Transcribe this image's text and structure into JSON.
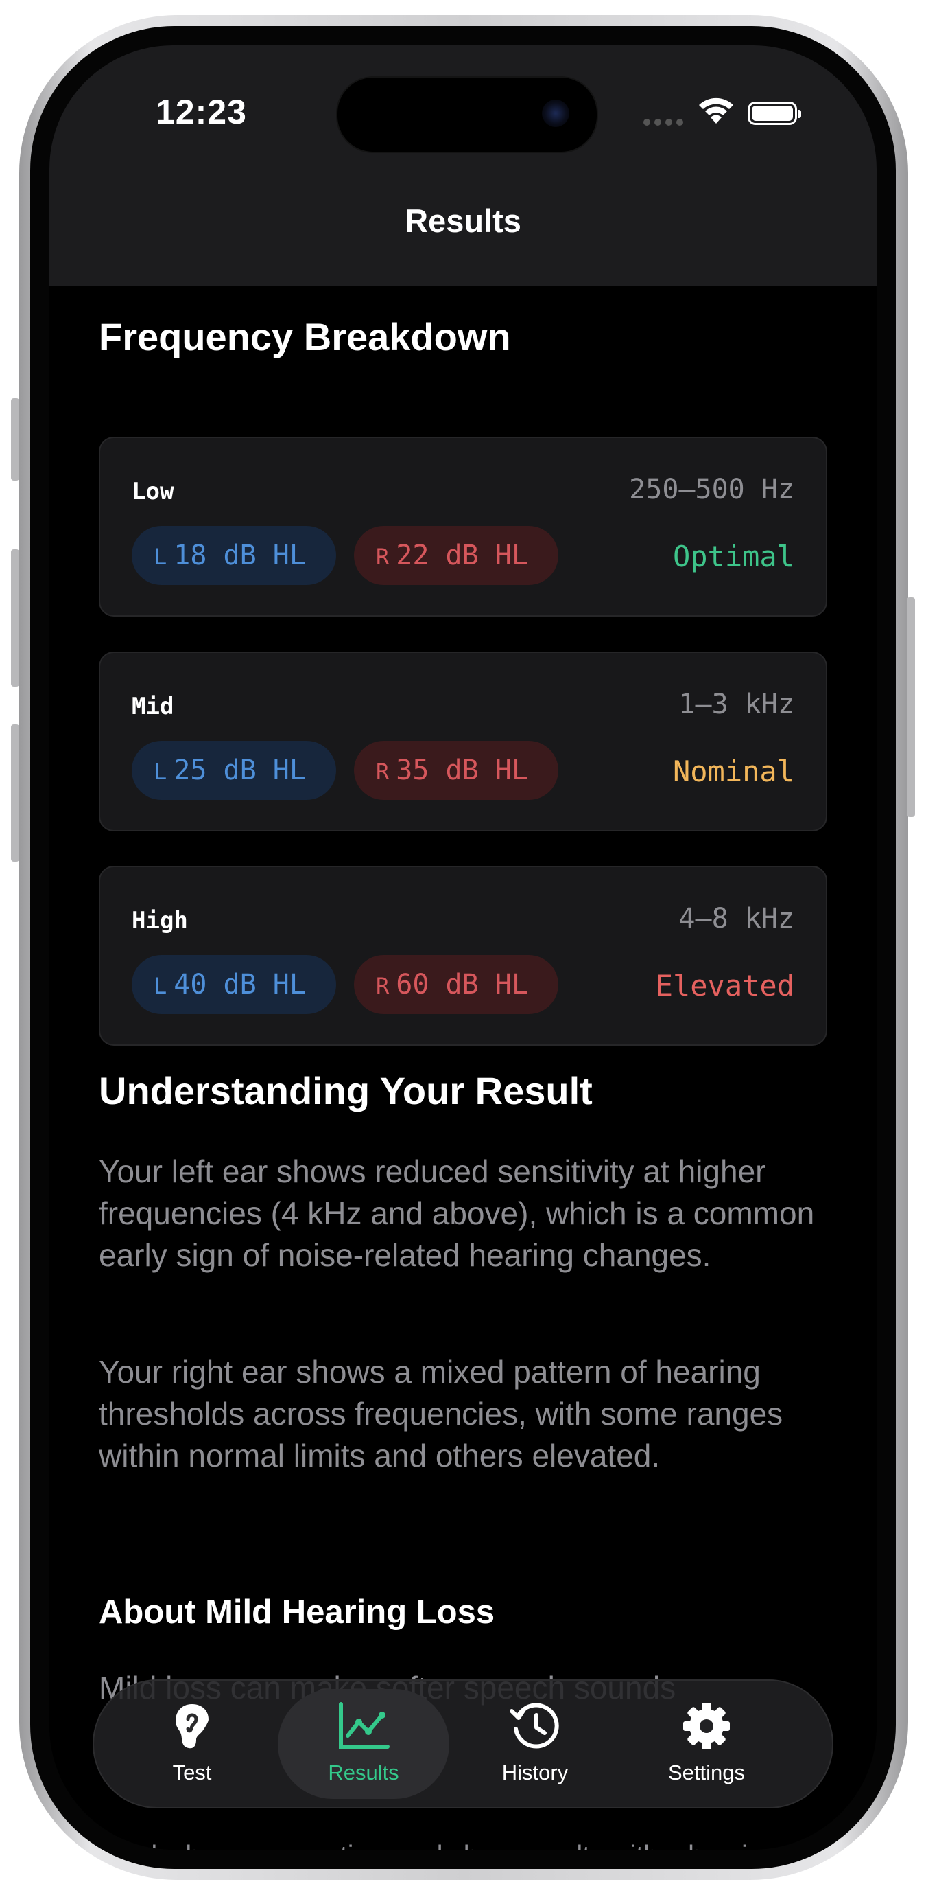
{
  "status_bar": {
    "time": "12:23"
  },
  "nav": {
    "title": "Results"
  },
  "breakdown": {
    "title": "Frequency Breakdown",
    "cards": [
      {
        "label": "Low",
        "range": "250–500 Hz",
        "left_side": "L",
        "left_value": "18 dB HL",
        "right_side": "R",
        "right_value": "22 dB HL",
        "status": "Optimal",
        "status_color": "#3ec48a"
      },
      {
        "label": "Mid",
        "range": "1–3 kHz",
        "left_side": "L",
        "left_value": "25 dB HL",
        "right_side": "R",
        "right_value": "35 dB HL",
        "status": "Nominal",
        "status_color": "#f2b65a"
      },
      {
        "label": "High",
        "range": "4–8 kHz",
        "left_side": "L",
        "left_value": "40 dB HL",
        "right_side": "R",
        "right_value": "60 dB HL",
        "status": "Elevated",
        "status_color": "#e5615f"
      }
    ]
  },
  "understanding": {
    "title": "Understanding Your Result",
    "paragraph1": "Your left ear shows reduced sensitivity at higher frequencies (4 kHz and above), which is a common early sign of noise-related hearing changes.",
    "paragraph2": "Your right ear shows a mixed pattern of hearing thresholds across frequencies, with some ranges within normal limits and others elevated."
  },
  "about": {
    "title": "About Mild Hearing Loss",
    "paragraph1": "Mild loss can make softer speech sounds",
    "paragraph2": "Track changes over time and share results with a hearing"
  },
  "tabbar": {
    "tabs": [
      {
        "label": "Test",
        "icon": "ear-icon"
      },
      {
        "label": "Results",
        "icon": "chart-line-icon"
      },
      {
        "label": "History",
        "icon": "history-clock-icon"
      },
      {
        "label": "Settings",
        "icon": "gear-icon"
      }
    ],
    "active_color": "#34c98b"
  }
}
